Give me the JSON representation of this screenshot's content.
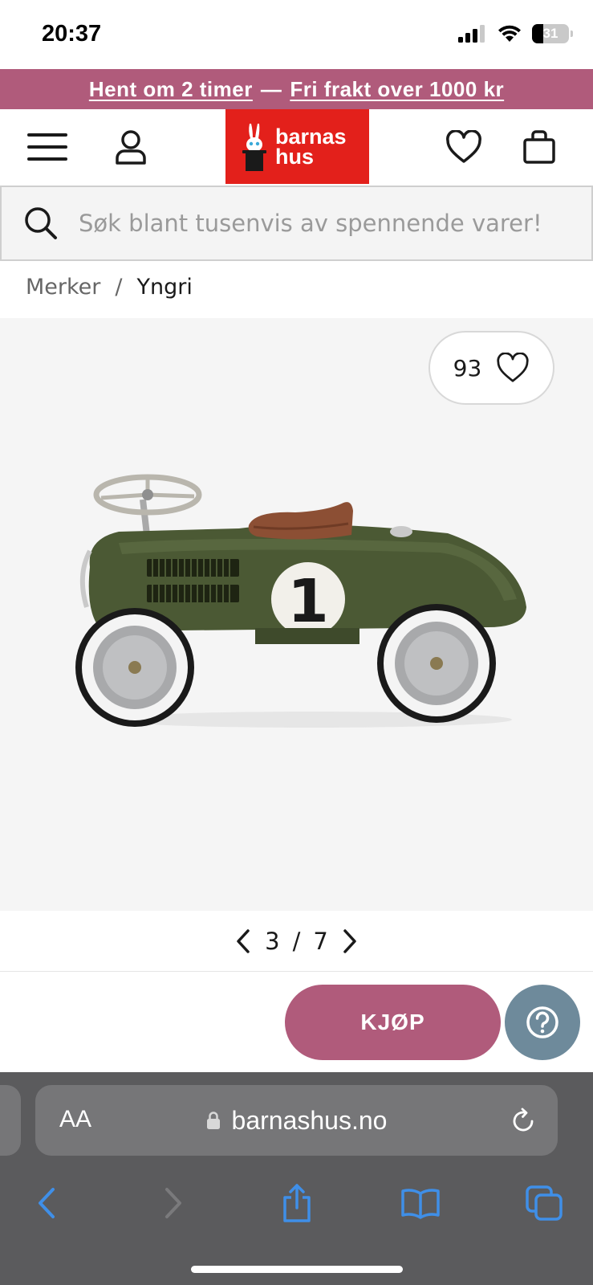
{
  "status_bar": {
    "time": "20:37",
    "battery": "31",
    "battery_level": 0.31
  },
  "promo": {
    "pickup": "Hent om 2 timer",
    "separator": "—",
    "shipping": "Fri frakt over 1000 kr"
  },
  "header": {
    "icons": [
      "menu-icon",
      "user-icon",
      "heart-icon",
      "bag-icon"
    ],
    "logo_line1": "barnas",
    "logo_line2": "hus"
  },
  "search": {
    "placeholder": "Søk blant tusenvis av spennende varer!"
  },
  "breadcrumb": {
    "parent": "Merker",
    "separator": "/",
    "current": "Yngri"
  },
  "product": {
    "favorites_count": "93",
    "car_number": "1",
    "image_index": "3",
    "image_separator": "/",
    "image_total": "7"
  },
  "actions": {
    "buy_label": "KJØP",
    "help_icon": "question-icon"
  },
  "browser": {
    "text_size": "AA",
    "url": "barnashus.no"
  },
  "colors": {
    "brand": "#e3201b",
    "accent": "#b05b7b",
    "help": "#6e8a9b",
    "safari_link": "#3f8fe8"
  }
}
